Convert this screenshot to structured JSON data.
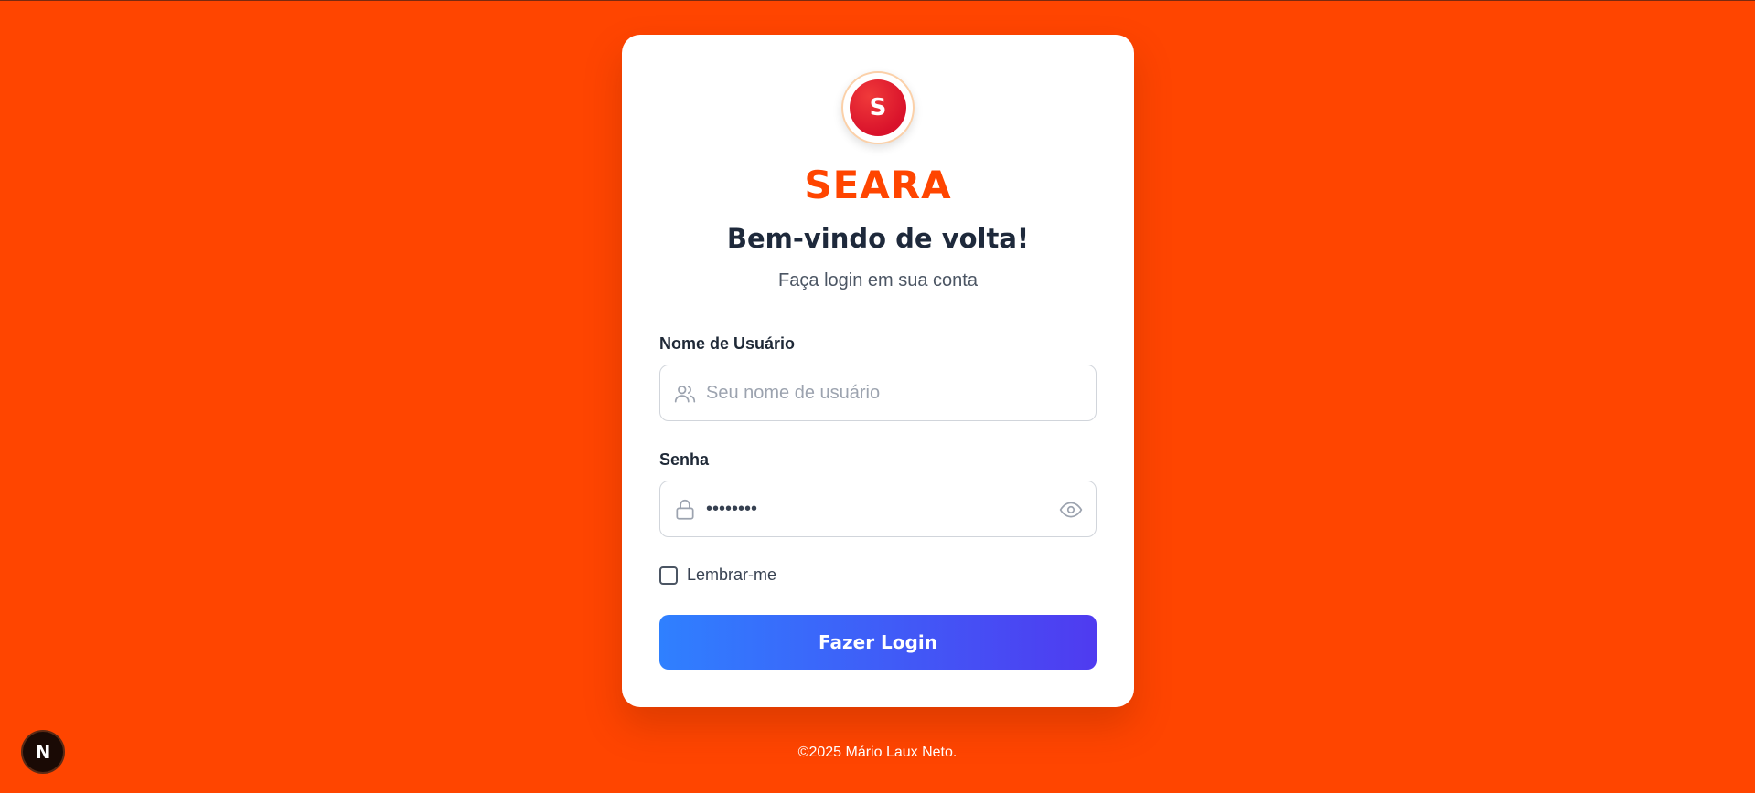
{
  "logo": {
    "letter": "S"
  },
  "brand": "SEARA",
  "welcome": "Bem-vindo de volta!",
  "subtitle": "Faça login em sua conta",
  "username": {
    "label": "Nome de Usuário",
    "placeholder": "Seu nome de usuário",
    "value": "",
    "icon": "users-icon"
  },
  "password": {
    "label": "Senha",
    "value": "••••••••",
    "icon": "lock-icon",
    "toggle_icon": "eye-icon"
  },
  "remember": {
    "label": "Lembrar-me",
    "checked": false
  },
  "login_button": "Fazer Login",
  "footer": "©2025 Mário Laux Neto.",
  "dev_badge": "N",
  "colors": {
    "background": "#ff4500",
    "brand": "#ff4500",
    "button_start": "#2f80ff",
    "button_end": "#4f3bf0"
  }
}
